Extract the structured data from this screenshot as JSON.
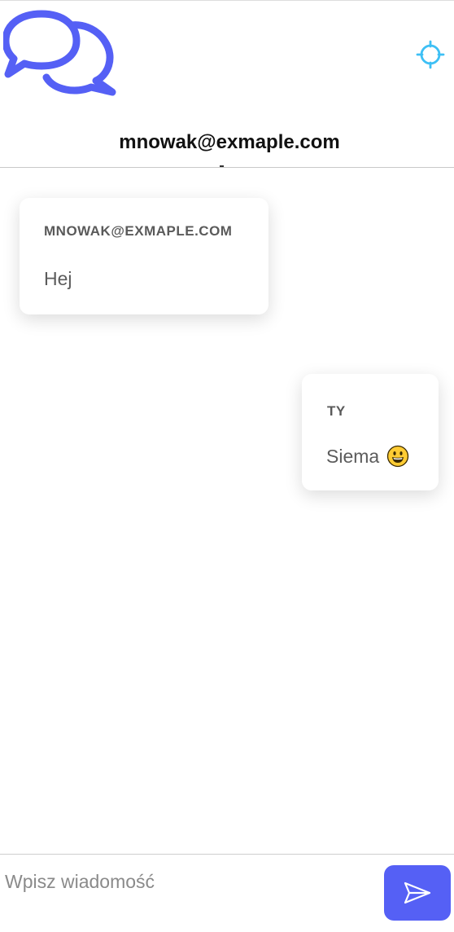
{
  "app": {
    "logo_icon": "chat-bubbles-icon",
    "brand_color": "#5560f5",
    "locate_icon": "crosshair-icon",
    "locate_color": "#3ec0f5"
  },
  "header": {
    "title": "mnowak@exmaple.com"
  },
  "messages": [
    {
      "sender": "MNOWAK@EXMAPLE.COM",
      "text": "Hej",
      "side": "left"
    },
    {
      "sender": "TY",
      "text": "Siema",
      "emoji": "grinning-face-emoji",
      "side": "right"
    }
  ],
  "composer": {
    "placeholder": "Wpisz wiadomość",
    "send_icon": "send-icon"
  }
}
